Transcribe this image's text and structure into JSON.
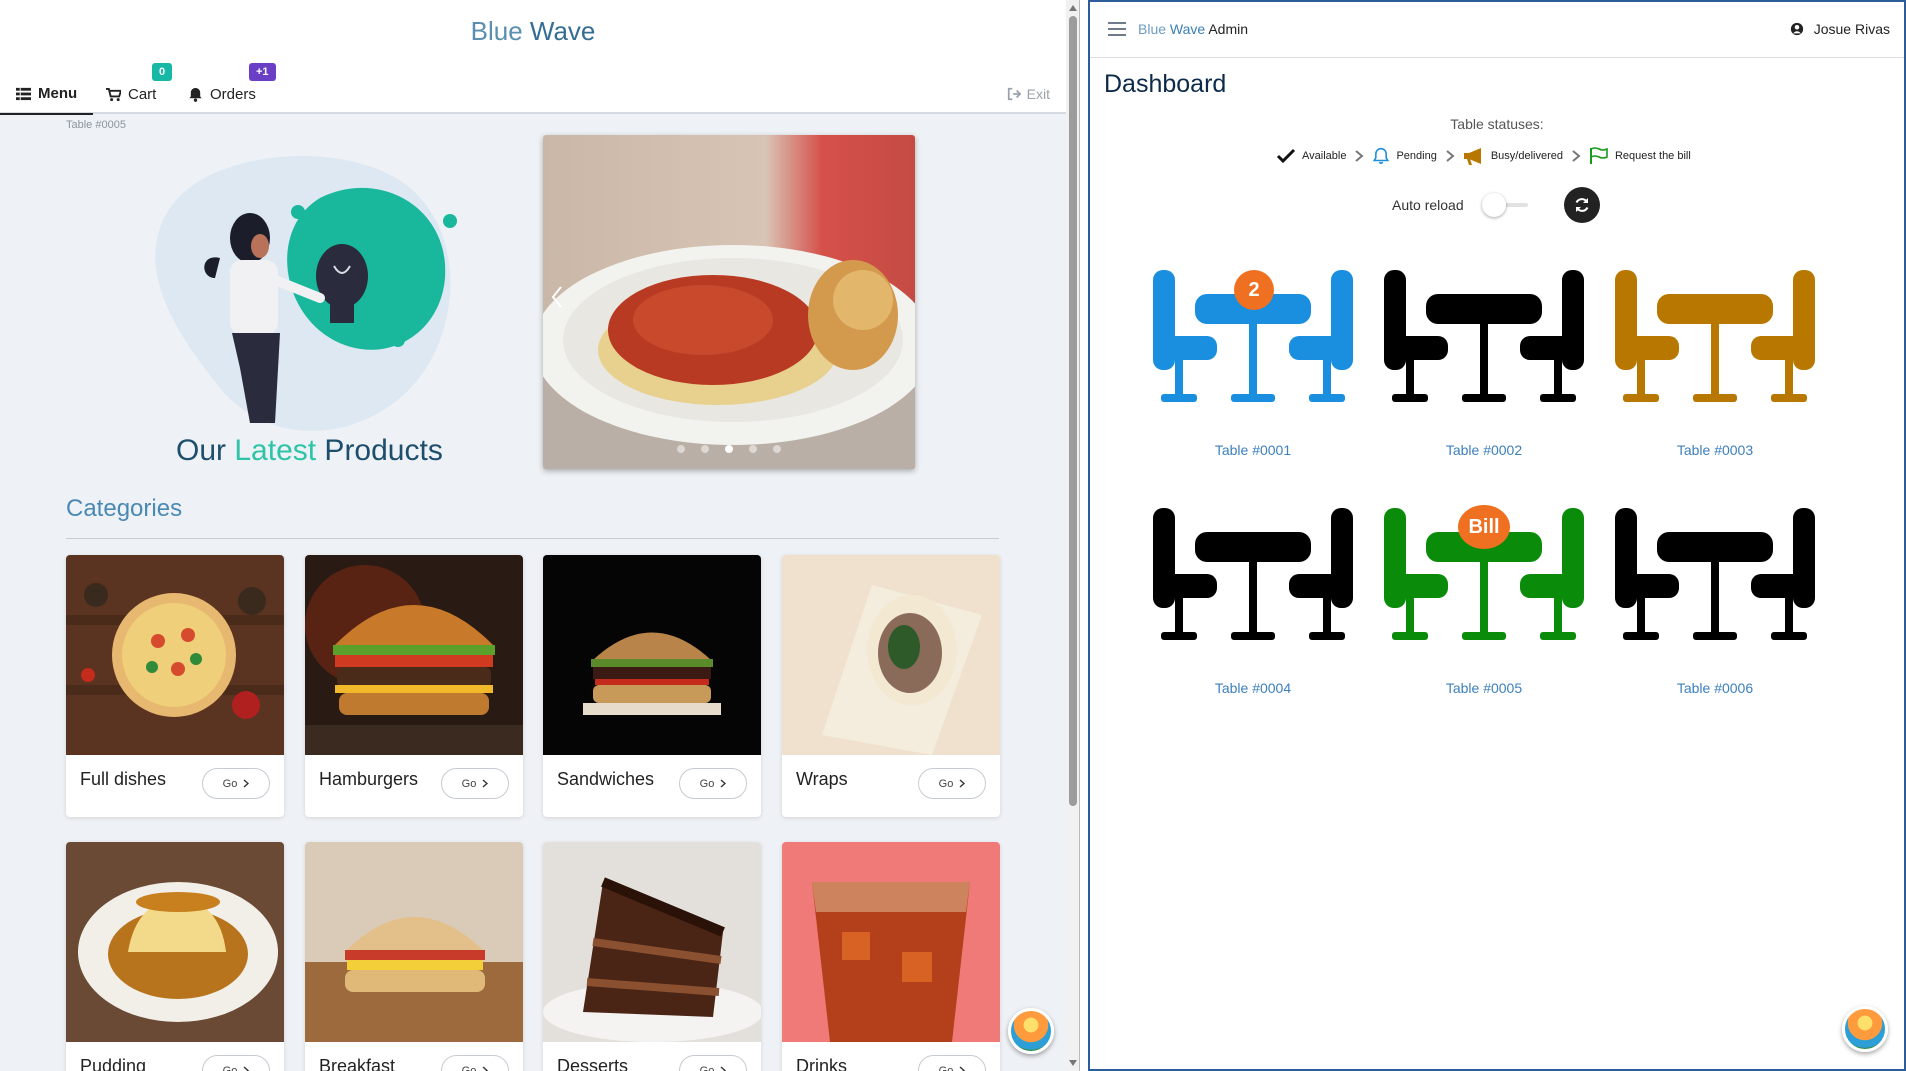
{
  "customer": {
    "brand": {
      "light": "Blue",
      "strong": "Wave"
    },
    "nav": {
      "menu": "Menu",
      "cart": "Cart",
      "cart_badge": "0",
      "orders": "Orders",
      "orders_badge": "+1",
      "exit": "Exit"
    },
    "table_tag": "Table #0005",
    "hero": {
      "part1": "Our ",
      "part2": "Latest",
      "part3": " Products"
    },
    "carousel": {
      "slides": 5,
      "active_index": 2
    },
    "categories_title": "Categories",
    "go_label": "Go",
    "categories": [
      {
        "name": "Full dishes",
        "icon": "pizza"
      },
      {
        "name": "Hamburgers",
        "icon": "burger"
      },
      {
        "name": "Sandwiches",
        "icon": "sandwich"
      },
      {
        "name": "Wraps",
        "icon": "wrap"
      },
      {
        "name": "Pudding",
        "icon": "flan"
      },
      {
        "name": "Breakfast",
        "icon": "breakfast-sandwich"
      },
      {
        "name": "Desserts",
        "icon": "cake"
      },
      {
        "name": "Drinks",
        "icon": "iced-tea"
      }
    ]
  },
  "admin": {
    "brand": {
      "light": "Blue",
      "strong": "Wave",
      "suffix": " Admin"
    },
    "user": "Josue Rivas",
    "title": "Dashboard",
    "statuses_title": "Table statuses:",
    "statuses": [
      {
        "label": "Available",
        "icon": "check-icon",
        "color": "#111111"
      },
      {
        "label": "Pending",
        "icon": "bell-icon",
        "color": "#1e8fd8"
      },
      {
        "label": "Busy/delivered",
        "icon": "megaphone-icon",
        "color": "#b87800"
      },
      {
        "label": "Request the bill",
        "icon": "flag-icon",
        "color": "#1a9a1a"
      }
    ],
    "auto_reload": "Auto reload",
    "tables": [
      {
        "label": "Table #0001",
        "color": "#1a8fe0",
        "badge": "2"
      },
      {
        "label": "Table #0002",
        "color": "#000000",
        "badge": ""
      },
      {
        "label": "Table #0003",
        "color": "#b87800",
        "badge": ""
      },
      {
        "label": "Table #0004",
        "color": "#000000",
        "badge": ""
      },
      {
        "label": "Table #0005",
        "color": "#0a8c0a",
        "badge": "Bill"
      },
      {
        "label": "Table #0006",
        "color": "#000000",
        "badge": ""
      }
    ]
  }
}
